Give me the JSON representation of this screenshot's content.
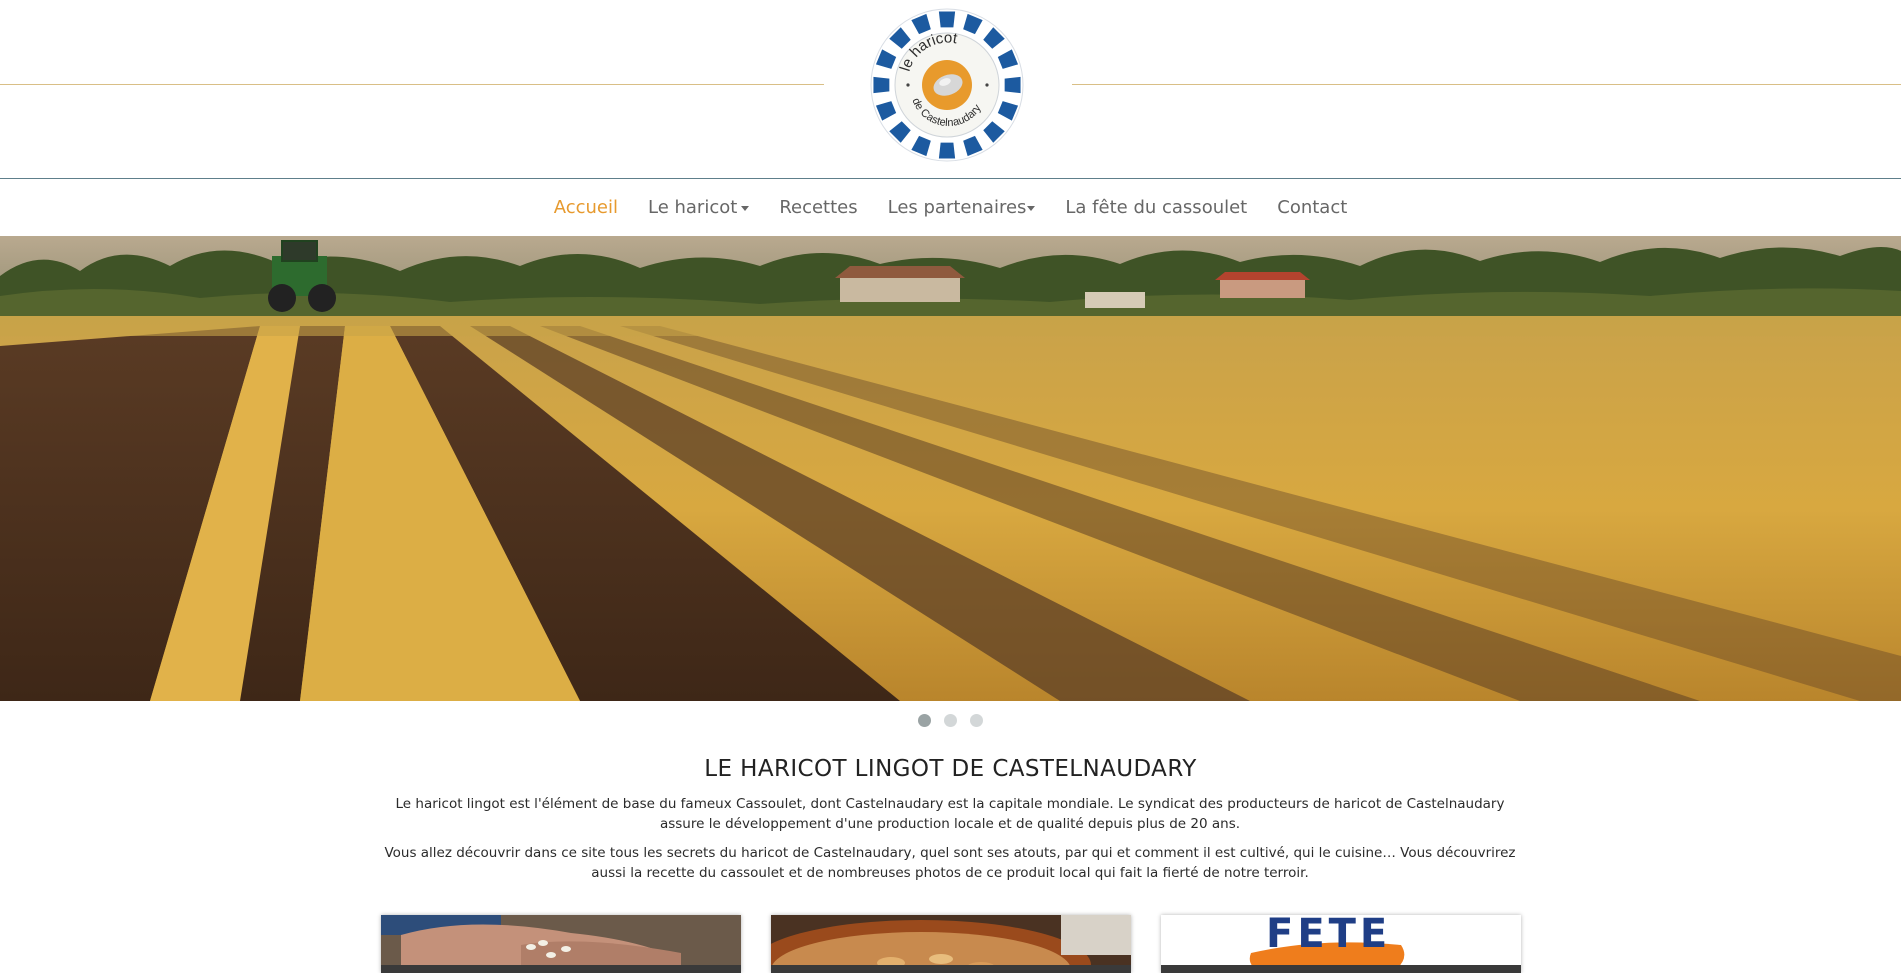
{
  "header": {
    "logo": {
      "text_top": "le haricot",
      "text_bottom": "de Castelnaudary",
      "ring_color": "#1c5aa0",
      "center_color": "#e89a2c"
    },
    "line_color": "#d9bf86"
  },
  "nav": {
    "items": [
      {
        "label": "Accueil",
        "active": true,
        "dropdown": false
      },
      {
        "label": "Le haricot",
        "active": false,
        "dropdown": true
      },
      {
        "label": "Recettes",
        "active": false,
        "dropdown": false
      },
      {
        "label": "Les partenaires",
        "active": false,
        "dropdown": true
      },
      {
        "label": "La fête du cassoulet",
        "active": false,
        "dropdown": false
      },
      {
        "label": "Contact",
        "active": false,
        "dropdown": false
      }
    ],
    "active_color": "#e79a2e",
    "text_color": "#676767"
  },
  "carousel": {
    "slides": 3,
    "current": 1
  },
  "content": {
    "title": "LE HARICOT LINGOT DE CASTELNAUDARY",
    "paragraph1": "Le haricot lingot est l'élément de base du fameux Cassoulet, dont Castelnaudary est la capitale mondiale. Le syndicat des producteurs de haricot de Castelnaudary assure le développement d'une production locale et de qualité depuis plus de 20 ans.",
    "paragraph2": "Vous allez découvrir dans ce site tous les secrets du haricot de Castelnaudary, quel sont ses atouts, par qui et comment il est cultivé, qui le cuisine… Vous découvrirez aussi la recette du cassoulet et de nombreuses photos de ce produit local qui fait la fierté de notre terroir."
  },
  "cards": [
    {
      "name": "beans-in-hands"
    },
    {
      "name": "cassoulet-dish"
    },
    {
      "name": "fete-poster",
      "text": "FETE"
    }
  ]
}
